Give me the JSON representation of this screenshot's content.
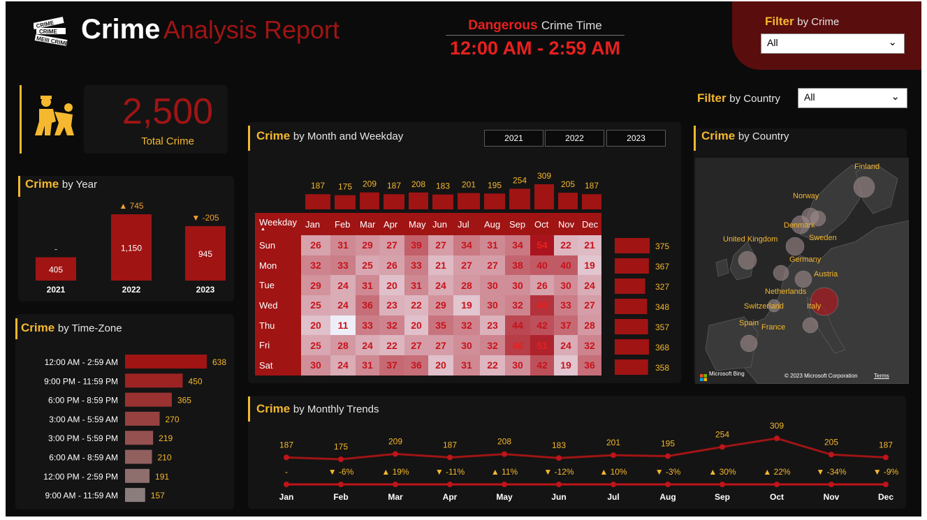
{
  "header": {
    "logo_icon": "crime-scene-tape-icon",
    "title_bold": "Crime",
    "title_rest": "Analysis Report",
    "dangerous_label_bold": "Dangerous",
    "dangerous_label_rest": "Crime Time",
    "dangerous_value": "12:00 AM - 2:59 AM"
  },
  "filters": {
    "crime_label_bold": "Filter",
    "crime_label_rest": "by Crime",
    "crime_value": "All",
    "country_label_bold": "Filter",
    "country_label_rest": "by Country",
    "country_value": "All"
  },
  "kpi": {
    "icon": "police-arrest-icon",
    "value": "2,500",
    "label": "Total Crime"
  },
  "titles": {
    "year_bold": "Crime",
    "year_rest": "by Year",
    "tz_bold": "Crime",
    "tz_rest": "by Time-Zone",
    "month_bold": "Crime",
    "month_rest": "by Month and Weekday",
    "country_bold": "Crime",
    "country_rest": "by Country",
    "trend_bold": "Crime",
    "trend_rest": "by Monthly Trends"
  },
  "year_buttons": [
    "2021",
    "2022",
    "2023"
  ],
  "map": {
    "attribution_brand": "Microsoft Bing",
    "copyright": "© 2023 Microsoft Corporation",
    "terms": "Terms",
    "countries": [
      "Finland",
      "Norway",
      "Denmark",
      "Sweden",
      "United Kingdom",
      "Germany",
      "Austria",
      "Netherlands",
      "Switzerland",
      "Italy",
      "Spain",
      "France"
    ]
  },
  "colors": {
    "accent_red": "#a01414",
    "bright_red": "#e8201e",
    "gold": "#f5b82e",
    "background": "#0b0b0b",
    "panel": "#141414"
  },
  "chart_data": [
    {
      "type": "bar",
      "name_ref": "Crime by Year",
      "categories": [
        "2021",
        "2022",
        "2023"
      ],
      "values": [
        405,
        1150,
        945
      ],
      "value_labels": [
        "405",
        "1,150",
        "945"
      ],
      "change_labels": [
        "-",
        "745",
        "-205"
      ],
      "change_dirs": [
        "none",
        "up",
        "down"
      ]
    },
    {
      "type": "bar",
      "orientation": "horizontal",
      "name_ref": "Crime by Time-Zone",
      "categories": [
        "12:00 AM - 2:59 AM",
        "9:00 PM - 11:59 PM",
        "6:00 PM - 8:59 PM",
        "3:00 AM - 5:59 AM",
        "3:00 PM - 5:59 PM",
        "6:00 AM - 8:59 AM",
        "12:00 PM - 2:59 PM",
        "9:00 AM - 11:59 AM"
      ],
      "values": [
        638,
        450,
        365,
        270,
        219,
        210,
        191,
        157
      ]
    },
    {
      "type": "heatmap",
      "name_ref": "Crime by Month and Weekday",
      "corner_label": "Weekday",
      "months": [
        "Jan",
        "Feb",
        "Mar",
        "Apr",
        "May",
        "Jun",
        "Jul",
        "Aug",
        "Sep",
        "Oct",
        "Nov",
        "Dec"
      ],
      "weekdays": [
        "Sun",
        "Mon",
        "Tue",
        "Wed",
        "Thu",
        "Fri",
        "Sat"
      ],
      "values": [
        [
          26,
          31,
          29,
          27,
          39,
          27,
          34,
          31,
          34,
          54,
          22,
          21
        ],
        [
          32,
          33,
          25,
          26,
          33,
          21,
          27,
          27,
          38,
          40,
          40,
          19
        ],
        [
          29,
          24,
          31,
          20,
          31,
          24,
          28,
          30,
          30,
          26,
          30,
          24
        ],
        [
          25,
          24,
          36,
          23,
          22,
          29,
          19,
          30,
          32,
          48,
          33,
          27
        ],
        [
          20,
          11,
          33,
          32,
          20,
          35,
          32,
          23,
          44,
          42,
          37,
          28
        ],
        [
          25,
          28,
          24,
          22,
          27,
          27,
          30,
          32,
          46,
          51,
          24,
          32
        ],
        [
          30,
          24,
          31,
          37,
          36,
          20,
          31,
          22,
          30,
          42,
          19,
          36
        ]
      ],
      "month_totals": [
        187,
        175,
        209,
        187,
        208,
        183,
        201,
        195,
        254,
        309,
        205,
        187
      ],
      "weekday_totals": [
        375,
        367,
        327,
        348,
        357,
        368,
        358
      ]
    },
    {
      "type": "line",
      "name_ref": "Crime by Monthly Trends",
      "categories": [
        "Jan",
        "Feb",
        "Mar",
        "Apr",
        "May",
        "Jun",
        "Jul",
        "Aug",
        "Sep",
        "Oct",
        "Nov",
        "Dec"
      ],
      "values": [
        187,
        175,
        209,
        187,
        208,
        183,
        201,
        195,
        254,
        309,
        205,
        187
      ],
      "change_labels": [
        "-",
        "-6%",
        "19%",
        "-11%",
        "11%",
        "-12%",
        "10%",
        "-3%",
        "30%",
        "22%",
        "-34%",
        "-9%"
      ],
      "change_dirs": [
        "none",
        "down",
        "up",
        "down",
        "up",
        "down",
        "up",
        "down",
        "up",
        "up",
        "down",
        "down"
      ]
    }
  ]
}
